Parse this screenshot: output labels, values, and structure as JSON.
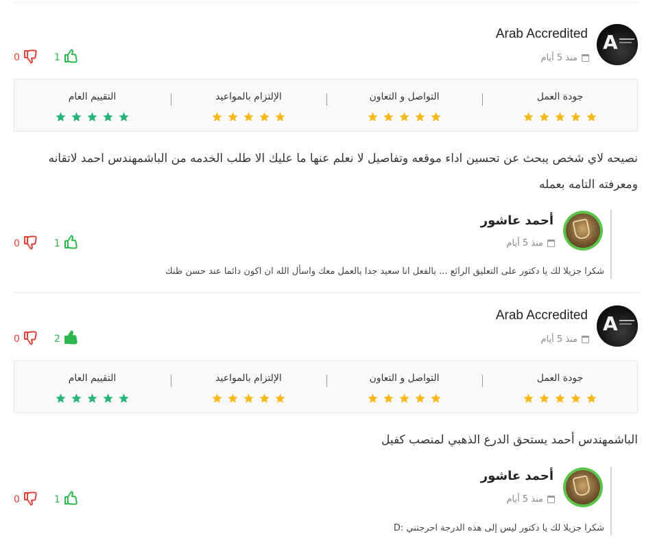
{
  "colors": {
    "star_gold": "#f6b91a",
    "star_green": "#26b574",
    "like_green": "#2db84d",
    "dislike_red": "#e0403a",
    "avatar_ring_green": "#5cc44a"
  },
  "icons": {
    "like": "thumbs-up-icon",
    "dislike": "thumbs-down-icon",
    "date": "calendar-icon",
    "star": "star-icon"
  },
  "rating_labels": [
    "جودة العمل",
    "التواصل و التعاون",
    "الإلتزام بالمواعيد",
    "التقييم العام"
  ],
  "rating_labels_2": [
    "جودة العمل",
    "التواصل و التعاون",
    "الإلتزام بالمواعيد",
    "التقييم العام"
  ],
  "reviews": [
    {
      "author": "Arab Accredited",
      "date": "منذ 5 أيام",
      "likes": "1",
      "dislikes": "0",
      "ratings": {
        "work_quality": 5,
        "communication": 5,
        "deadlines": 5,
        "overall": 5
      },
      "comment": "نصيحه لاي شخص يبحث عن تحسين اداء موقعه وتفاصيل لا نعلم عنها ما عليك الا طلب الخدمه من الباشمهندس احمد لاتقانه ومعرفته التامه بعمله",
      "reply": {
        "author": "أحمد عاشور",
        "date": "منذ 5 أيام",
        "likes": "1",
        "dislikes": "0",
        "text": "شكرا جزيلا لك يا دكتور على التعليق الرائع ... بالفعل انا سعيد جدا بالعمل معك واسأل الله ان اكون دائما عند حسن ظنك"
      }
    },
    {
      "author": "Arab Accredited",
      "date": "منذ 5 أيام",
      "likes": "2",
      "dislikes": "0",
      "ratings": {
        "work_quality": 5,
        "communication": 5,
        "deadlines": 5,
        "overall": 5
      },
      "comment": "الباشمهندس أحمد يستحق الدرع الذهبي لمنصب كفيل",
      "reply": {
        "author": "أحمد عاشور",
        "date": "منذ 5 أيام",
        "likes": "1",
        "dislikes": "0",
        "text": "شكرا جزيلا لك يا دكتور ليس إلى هذه الدرجة احرجتني :D"
      }
    }
  ]
}
